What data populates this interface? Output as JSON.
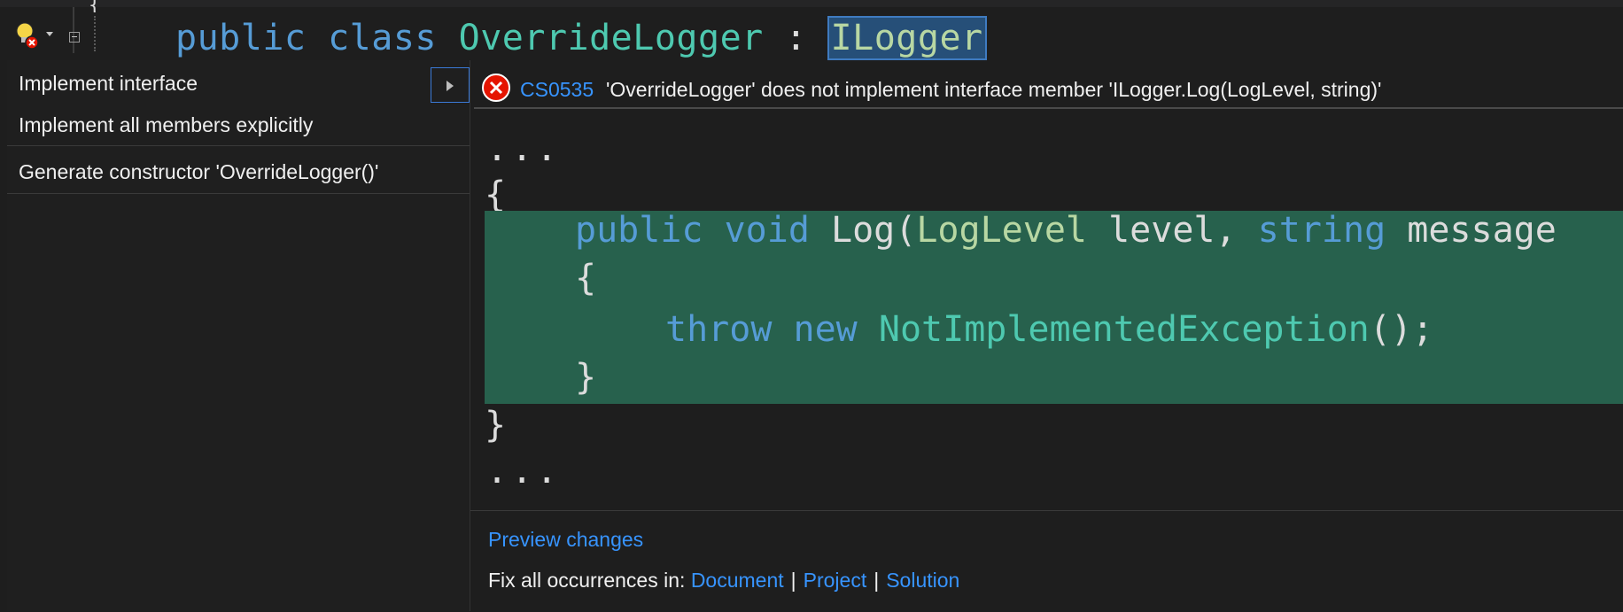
{
  "editor": {
    "brace_text": "{",
    "header_keyword_public": "public",
    "header_keyword_class": "class",
    "header_class_name": "OverrideLogger",
    "header_colon": ":",
    "header_interface": "ILogger"
  },
  "quick_actions": {
    "items": [
      {
        "label": "Implement interface"
      },
      {
        "label": "Implement all members explicitly"
      },
      {
        "label": "Generate constructor 'OverrideLogger()'"
      }
    ]
  },
  "diagnostic": {
    "code": "CS0535",
    "message": "'OverrideLogger' does not implement interface member 'ILogger.Log(LogLevel, string)'"
  },
  "preview_code": {
    "ellipsis": "...",
    "brace_open": "{",
    "brace_close": "}",
    "sig_public": "public",
    "sig_void": "void",
    "sig_name": "Log(",
    "sig_type1": "LogLevel",
    "sig_param1": " level, ",
    "sig_type2": "string",
    "sig_param2": " message",
    "throw_kw": "throw",
    "new_kw": "new",
    "exception_type": "NotImplementedException",
    "throw_tail": "();"
  },
  "footer": {
    "preview_changes": "Preview changes",
    "fix_all_label": "Fix all occurrences in:",
    "scope_document": "Document",
    "scope_project": "Project",
    "scope_solution": "Solution",
    "separator": "|"
  },
  "colors": {
    "keyword": "#569cd6",
    "type": "#4ec9b0",
    "interface": "#b8d7a3",
    "added_highlight": "#27614d",
    "link": "#3794ff",
    "error": "#e51400"
  }
}
